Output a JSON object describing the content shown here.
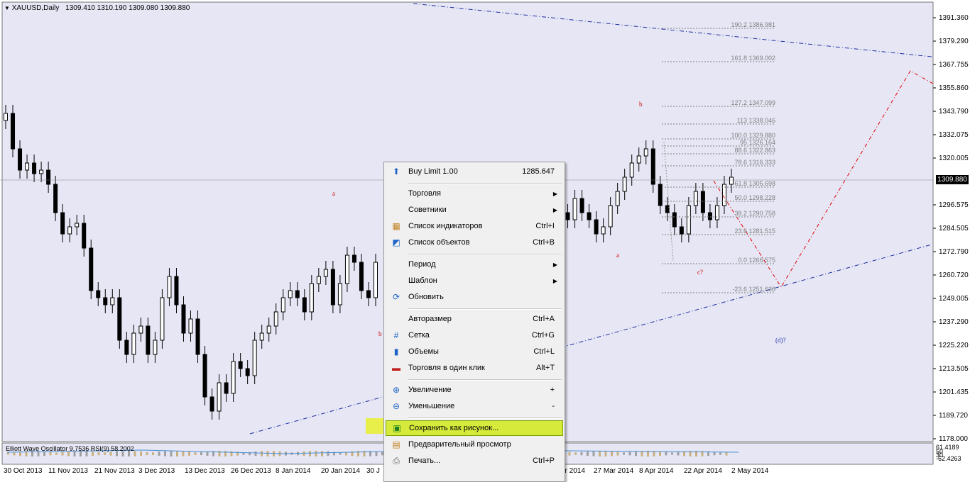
{
  "chart": {
    "title": "XAUUSD,Daily",
    "ohlc": "1309.410 1310.190 1309.080 1309.880",
    "current_price": "1309.880",
    "price_axis": [
      "1391.360",
      "1379.290",
      "1367.755",
      "1355.860",
      "1343.790",
      "1332.075",
      "1320.005",
      "1296.575",
      "1284.505",
      "1272.790",
      "1260.720",
      "1249.005",
      "1237.290",
      "1225.220",
      "1213.505",
      "1201.435",
      "1189.720",
      "1178.000"
    ],
    "time_axis": [
      "30 Oct 2013",
      "11 Nov 2013",
      "21 Nov 2013",
      "3 Dec 2013",
      "13 Dec 2013",
      "26 Dec 2013",
      "8 Jan 2014",
      "20 Jan 2014",
      "30 J",
      "ar 2014",
      "27 Mar 2014",
      "8 Apr 2014",
      "22 Apr 2014",
      "2 May 2014"
    ],
    "wave_labels": [
      "a",
      "b",
      "b",
      "a",
      "c?",
      "(d)?"
    ],
    "fib_levels": [
      "190.2 1386.981",
      "161.8 1369.002",
      "127.2 1347.099",
      "113 1338.046",
      "100.0 1329.880",
      "95 1326.164",
      "88.6 1322.863",
      "78.6 1316.333",
      "61.8 1305.698",
      "50.0 1298.228",
      "38.2 1290.758",
      "23.6 1281.515",
      "0.0 1266.575",
      "-23.6 1251.636"
    ],
    "oscillator": {
      "label": "Elliott Wave Oscillator  9.7536  RSI(9) 58.2002",
      "axis": [
        "61.4189",
        "50",
        "30",
        "-62.4263"
      ]
    },
    "colors": {
      "background": "#e6e6f5",
      "bull": "#ffffff",
      "bear": "#000000",
      "trendline": "#2030a0",
      "fib": "#808080",
      "projection": "#e00000"
    }
  },
  "menu": {
    "items": [
      {
        "icon": "arrow-up-icon",
        "label": "Buy Limit 1.00",
        "shortcut": "1285.647",
        "submenu": false
      },
      {
        "icon": "",
        "label": "Торговля",
        "shortcut": "",
        "submenu": true
      },
      {
        "icon": "",
        "label": "Советники",
        "shortcut": "",
        "submenu": true
      },
      {
        "icon": "indicators-list-icon",
        "label": "Список индикаторов",
        "shortcut": "Ctrl+I",
        "submenu": false
      },
      {
        "icon": "objects-list-icon",
        "label": "Список объектов",
        "shortcut": "Ctrl+B",
        "submenu": false
      },
      {
        "icon": "",
        "label": "Период",
        "shortcut": "",
        "submenu": true
      },
      {
        "icon": "",
        "label": "Шаблон",
        "shortcut": "",
        "submenu": true
      },
      {
        "icon": "refresh-icon",
        "label": "Обновить",
        "shortcut": "",
        "submenu": false
      },
      {
        "icon": "",
        "label": "Авторазмер",
        "shortcut": "Ctrl+A",
        "submenu": false
      },
      {
        "icon": "grid-icon",
        "label": "Сетка",
        "shortcut": "Ctrl+G",
        "submenu": false
      },
      {
        "icon": "volumes-icon",
        "label": "Объемы",
        "shortcut": "Ctrl+L",
        "submenu": false
      },
      {
        "icon": "one-click-icon",
        "label": "Торговля в один клик",
        "shortcut": "Alt+T",
        "submenu": false
      },
      {
        "icon": "zoom-in-icon",
        "label": "Увеличение",
        "shortcut": "+",
        "submenu": false
      },
      {
        "icon": "zoom-out-icon",
        "label": "Уменьшение",
        "shortcut": "-",
        "submenu": false
      },
      {
        "icon": "save-picture-icon",
        "label": "Сохранить как рисунок...",
        "shortcut": "",
        "submenu": false
      },
      {
        "icon": "preview-icon",
        "label": "Предварительный просмотр",
        "shortcut": "",
        "submenu": false
      },
      {
        "icon": "print-icon",
        "label": "Печать...",
        "shortcut": "Ctrl+P",
        "submenu": false
      }
    ]
  }
}
